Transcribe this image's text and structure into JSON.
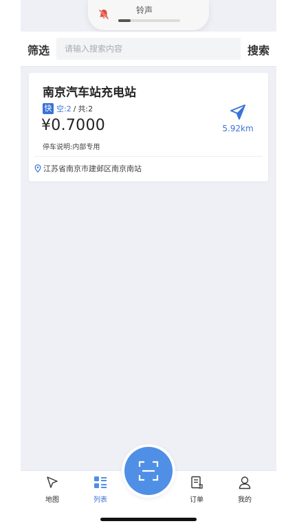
{
  "notification": {
    "title": "铃声",
    "icon": "bell-muted-icon",
    "volume_fraction": 0.2
  },
  "header": {
    "filter_label": "筛选",
    "search_placeholder": "请输入搜索内容",
    "search_value": "",
    "search_label": "搜索"
  },
  "station": {
    "name": "南京汽车站充电站",
    "fast_tag": "快",
    "free_text": "空:2",
    "separator": "/",
    "total_text": "共:2",
    "price": "¥0.7000",
    "note": "停车说明:内部专用",
    "distance": "5.92km",
    "address": "江苏省南京市建邺区南京南站"
  },
  "tabs": [
    {
      "label": "地图",
      "icon": "map-nav-icon",
      "active": false
    },
    {
      "label": "列表",
      "icon": "list-icon",
      "active": true
    },
    {
      "label": "订单",
      "icon": "order-icon",
      "active": false
    },
    {
      "label": "我的",
      "icon": "user-icon",
      "active": false
    }
  ],
  "colors": {
    "accent": "#3a72d8",
    "scan_button": "#4f8fe6",
    "background": "#eef0f6"
  }
}
